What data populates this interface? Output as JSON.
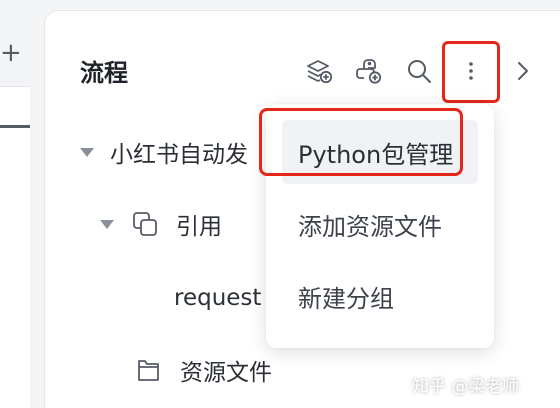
{
  "left": {
    "add_symbol": "+"
  },
  "panel": {
    "title": "流程",
    "toolbar": {
      "layers_icon": "layers-plus-icon",
      "python_icon": "python-add-icon",
      "search_icon": "search-icon",
      "more_icon": "more-vertical-icon",
      "collapse_icon": "chevron-right-icon"
    }
  },
  "tree": {
    "root": {
      "label": "小红书自动发"
    },
    "refs": {
      "label": "引用"
    },
    "request": {
      "label": "request"
    },
    "resources": {
      "label": "资源文件"
    }
  },
  "menu": {
    "items": [
      {
        "label": "Python包管理",
        "highlighted": true
      },
      {
        "label": "添加资源文件"
      },
      {
        "label": "新建分组"
      }
    ]
  },
  "watermark": "知乎 @梁老师",
  "colors": {
    "highlight": "#e3271b",
    "caret": "#8a8f99"
  }
}
